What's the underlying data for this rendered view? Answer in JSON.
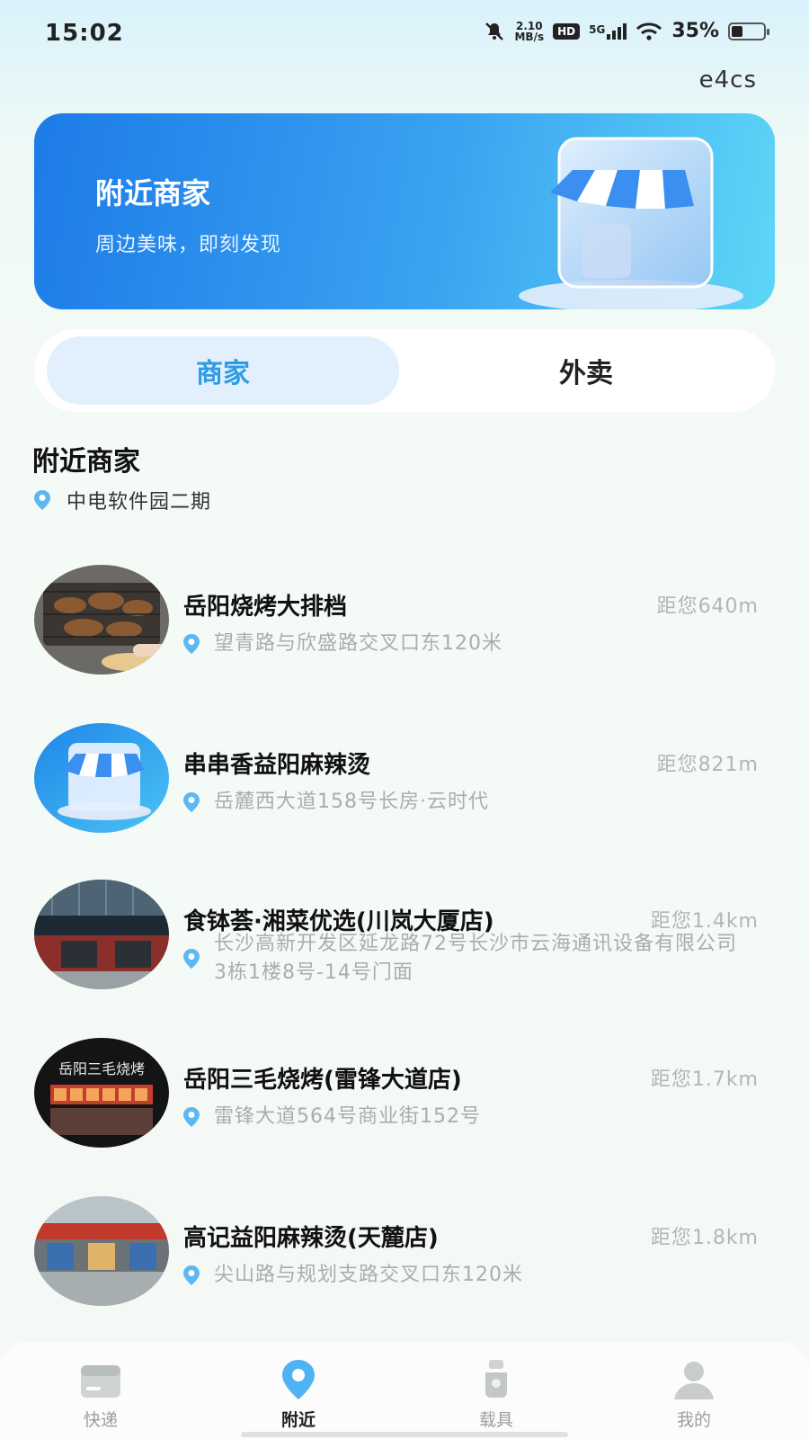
{
  "status_bar": {
    "time": "15:02",
    "net_speed_value": "2.10",
    "net_speed_unit": "MB/s",
    "hd": "HD",
    "network": "5G",
    "battery_percent": "35%"
  },
  "header": {
    "user_code": "e4cs"
  },
  "banner": {
    "title": "附近商家",
    "subtitle": "周边美味，即刻发现"
  },
  "tabs": [
    {
      "label": "商家",
      "active": true
    },
    {
      "label": "外卖",
      "active": false
    }
  ],
  "section": {
    "title": "附近商家",
    "location": "中电软件园二期"
  },
  "shops": [
    {
      "name": "岳阳烧烤大排档",
      "distance": "距您640m",
      "address": "望青路与欣盛路交叉口东120米",
      "thumb": "bbq-grill-photo"
    },
    {
      "name": "串串香益阳麻辣烫",
      "distance": "距您821m",
      "address": "岳麓西大道158号长房·云时代",
      "thumb": "store-placeholder"
    },
    {
      "name": "食钵荟·湘菜优选(川岚大厦店)",
      "distance": "距您1.4km",
      "address": "长沙高新开发区延龙路72号长沙市云海通讯设备有限公司3栋1楼8号-14号门面",
      "thumb": "storefront-photo"
    },
    {
      "name": "岳阳三毛烧烤(雷锋大道店)",
      "distance": "距您1.7km",
      "address": "雷锋大道564号商业街152号",
      "thumb": "night-storefront-photo",
      "thumb_sign": "岳阳三毛烧烤"
    },
    {
      "name": "高记益阳麻辣烫(天麓店)",
      "distance": "距您1.8km",
      "address": "尖山路与规划支路交叉口东120米",
      "thumb": "street-storefront-photo"
    }
  ],
  "bottom_nav": [
    {
      "label": "快递",
      "icon": "package-icon",
      "active": false
    },
    {
      "label": "附近",
      "icon": "location-pin-icon",
      "active": true
    },
    {
      "label": "载具",
      "icon": "scooter-icon",
      "active": false
    },
    {
      "label": "我的",
      "icon": "profile-icon",
      "active": false
    }
  ],
  "colors": {
    "accent": "#2f9be6",
    "banner_start": "#1d7be8",
    "banner_end": "#5ed6f7",
    "muted_text": "#aaadaf"
  }
}
